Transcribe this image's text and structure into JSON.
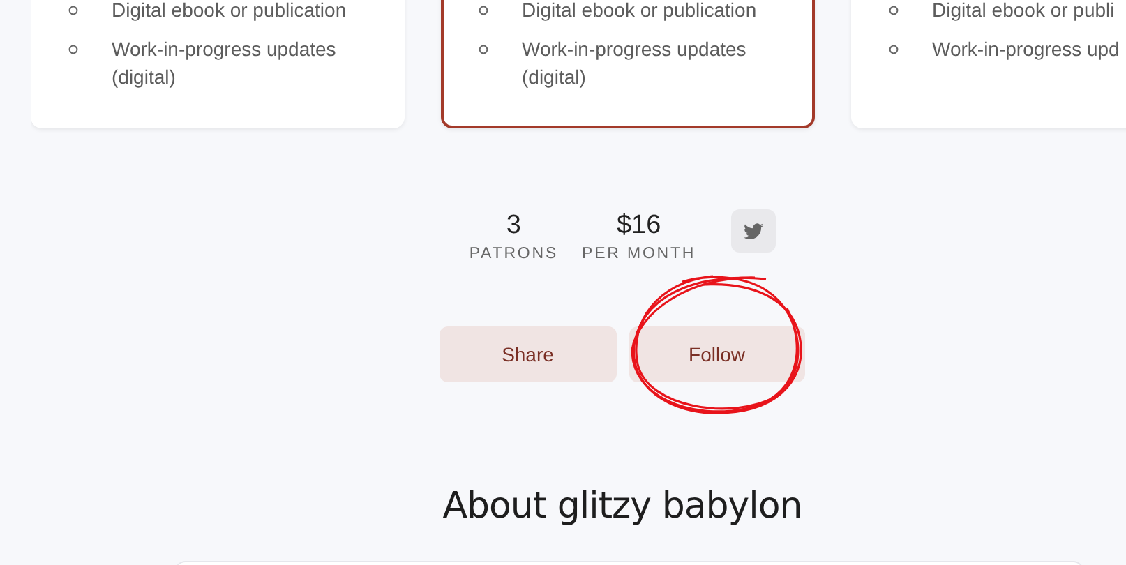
{
  "tiers": [
    {
      "selected": false,
      "benefits": [
        "Digital ebook or publication",
        "Work-in-progress updates (digital)"
      ]
    },
    {
      "selected": true,
      "benefits": [
        "Digital ebook or publication",
        "Work-in-progress updates (digital)"
      ]
    },
    {
      "selected": false,
      "benefits": [
        "Digital ebook or publi",
        "Work-in-progress upd"
      ]
    }
  ],
  "stats": [
    {
      "value": "3",
      "label": "PATRONS"
    },
    {
      "value": "$16",
      "label": "PER MONTH"
    }
  ],
  "social": [
    {
      "kind": "twitter"
    }
  ],
  "buttons": [
    "Share",
    "Follow"
  ],
  "about": {
    "title": "About glitzy babylon"
  },
  "annotation": {
    "kind": "scribble"
  }
}
